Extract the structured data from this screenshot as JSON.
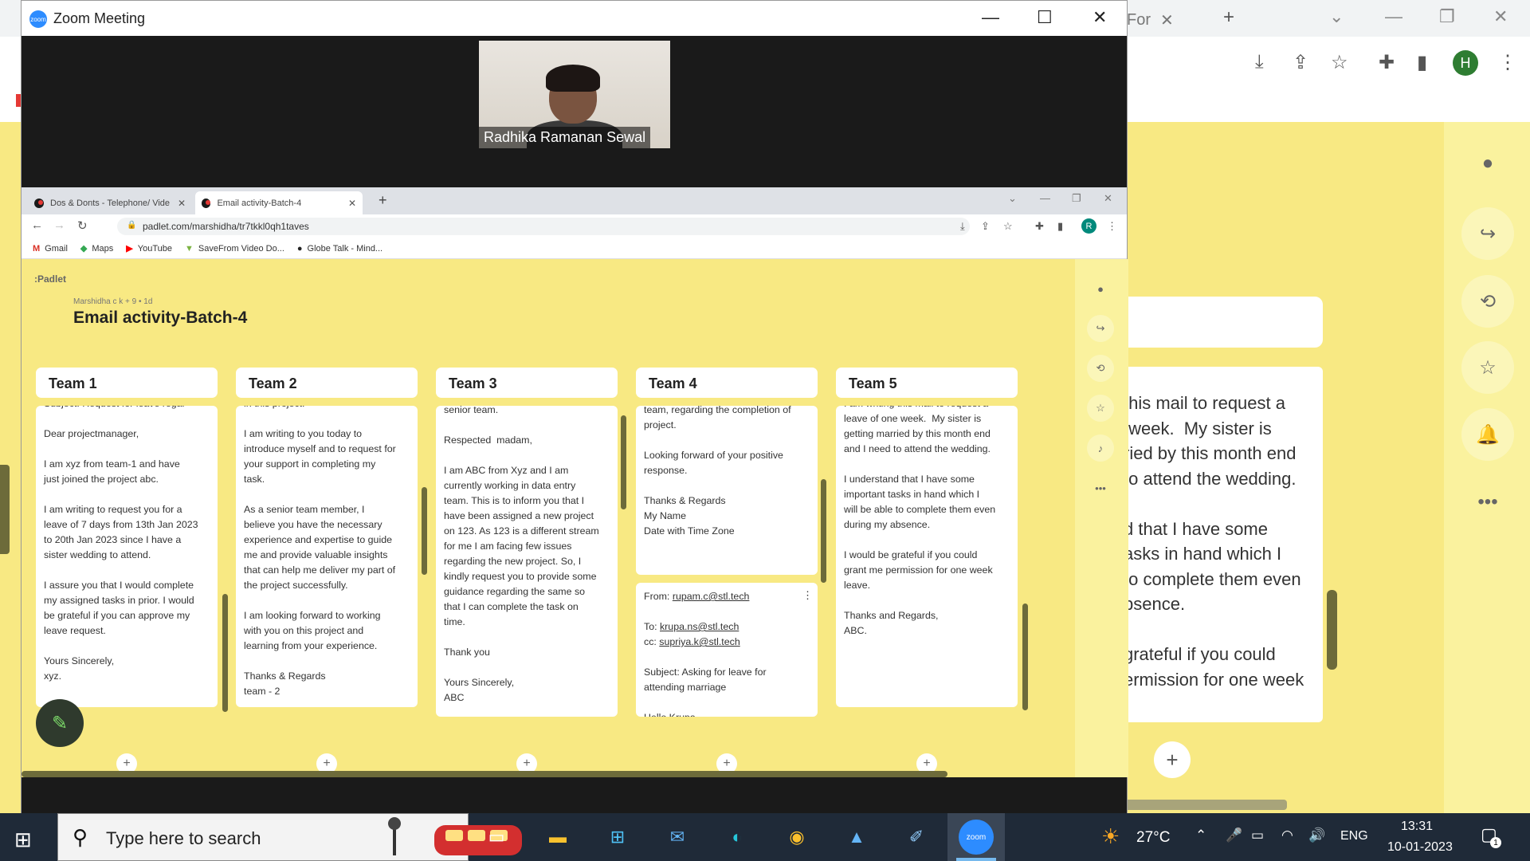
{
  "background": {
    "tab_label": "For",
    "avatar_letter": "H",
    "card_text": "this mail to request a\n week.  My sister is\nried by this month end\nto attend the wedding.\n\nd that I have some\nasks in hand which I\nto complete them even\nbsence.\n\ngrateful if you could\nermission for one week"
  },
  "zoom": {
    "title": "Zoom Meeting",
    "participant_name": "Radhika Ramanan Sewal"
  },
  "browser": {
    "tabs": [
      {
        "label": "Dos & Donts - Telephone/ Video"
      },
      {
        "label": "Email activity-Batch-4"
      }
    ],
    "url": "padlet.com/marshidha/tr7tkkl0qh1taves",
    "avatar_letter": "R",
    "bookmarks": [
      {
        "label": "Gmail",
        "icon": "M"
      },
      {
        "label": "Maps",
        "icon": "◆"
      },
      {
        "label": "YouTube",
        "icon": "▶"
      },
      {
        "label": "SaveFrom Video Do...",
        "icon": "▼"
      },
      {
        "label": "Globe Talk - Mind...",
        "icon": "●"
      }
    ]
  },
  "padlet": {
    "logo": ":Padlet",
    "meta": "Marshidha c k + 9 • 1d",
    "title": "Email activity-Batch-4",
    "columns": [
      {
        "title": "Team 1",
        "body": "Subject: Request for leave regar\n\nDear projectmanager,\n\nI am xyz from team-1 and have\njust joined the project abc.\n\nI am writing to request you for a\nleave of 7 days from 13th Jan 2023\nto 20th Jan 2023 since I have a\nsister wedding to attend.\n\nI assure you that I would complete\nmy assigned tasks in prior. I would\nbe grateful if you can approve my\nleave request.\n\nYours Sincerely,\nxyz."
      },
      {
        "title": "Team 2",
        "body": "in this project.\n\nI am writing to you today to\nintroduce myself and to request for\nyour support in completing my\ntask.\n\nAs a senior team member, I\nbelieve you have the necessary\nexperience and expertise to guide\nme and provide valuable insights\nthat can help me deliver my part of\nthe project successfully.\n\nI am looking forward to working\nwith you on this project and\nlearning from your experience.\n\nThanks & Regards\nteam - 2"
      },
      {
        "title": "Team 3",
        "body": "senior team.\n\nRespected  madam,\n\nI am ABC from Xyz and I am\ncurrently working in data entry\nteam. This is to inform you that I\nhave been assigned a new project\non 123. As 123 is a different stream\nfor me I am facing few issues\nregarding the new project. So, I\nkindly request you to provide some\nguidance regarding the same so\nthat I can complete the task on\ntime.\n\nThank you\n\nYours Sincerely,\nABC"
      },
      {
        "title": "Team 4",
        "body": "team, regarding the completion of\nproject.\n\nLooking forward of your positive\nresponse.\n\nThanks & Regards\nMy Name\nDate with Time Zone",
        "card2": {
          "from_label": "From:",
          "from": "rupam.c@stl.tech",
          "to_label": "To:",
          "to": "krupa.ns@stl.tech",
          "cc_label": "cc:",
          "cc": "supriya.k@stl.tech",
          "subject": "Subject: Asking for leave for\nattending marriage",
          "greeting": "Hello Krupa"
        }
      },
      {
        "title": "Team 5",
        "body": "I am writing this mail to request a\nleave of one week.  My sister is\ngetting married by this month end\nand I need to attend the wedding.\n\nI understand that I have some\nimportant tasks in hand which I\nwill be able to complete them even\nduring my absence.\n\nI would be grateful if you could\ngrant me permission for one week\nleave.\n\nThanks and Regards,\nABC."
      }
    ]
  },
  "taskbar": {
    "search_placeholder": "Type here to search",
    "temperature": "27°C",
    "language": "ENG",
    "time": "13:31",
    "date": "10-01-2023",
    "notification_count": "1"
  }
}
